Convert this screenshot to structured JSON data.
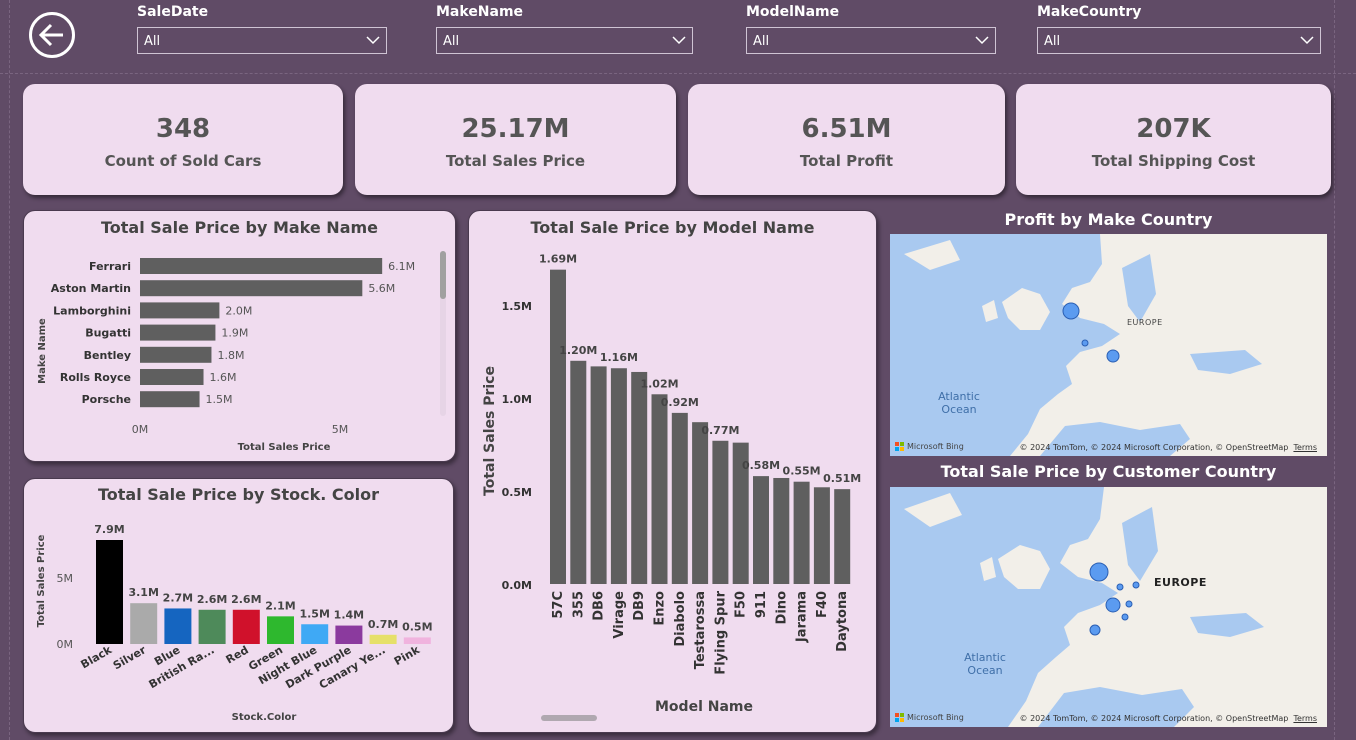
{
  "slicers": [
    {
      "title": "SaleDate",
      "value": "All"
    },
    {
      "title": "MakeName",
      "value": "All"
    },
    {
      "title": "ModelName",
      "value": "All"
    },
    {
      "title": "MakeCountry",
      "value": "All"
    }
  ],
  "kpis": [
    {
      "value": "348",
      "label": "Count of Sold Cars"
    },
    {
      "value": "25.17M",
      "label": "Total Sales Price"
    },
    {
      "value": "6.51M",
      "label": "Total Profit"
    },
    {
      "value": "207K",
      "label": "Total Shipping Cost"
    }
  ],
  "make_chart": {
    "title": "Total Sale Price by Make Name",
    "ylabel": "Make Name",
    "xlabel": "Total Sales Price",
    "ticks": [
      "0M",
      "5M"
    ]
  },
  "model_chart": {
    "title": "Total Sale Price by Model Name",
    "ylabel": "Total Sales Price",
    "xlabel": "Model Name",
    "ticks": [
      "0.0M",
      "0.5M",
      "1.0M",
      "1.5M"
    ]
  },
  "color_chart": {
    "title": "Total Sale Price by Stock. Color",
    "ylabel": "Total Sales Price",
    "xlabel": "Stock.Color",
    "ticks": [
      "0M",
      "5M"
    ]
  },
  "maps": {
    "profit": {
      "title": "Profit by Make Country",
      "ocean": "Atlantic\nOcean",
      "region": "EUROPE",
      "bing": "Microsoft Bing",
      "credit": "© 2024 TomTom, © 2024 Microsoft Corporation, © OpenStreetMap",
      "terms": "Terms"
    },
    "customer": {
      "title": "Total Sale Price by Customer Country",
      "ocean": "Atlantic\nOcean",
      "region": "EUROPE",
      "bing": "Microsoft Bing",
      "credit": "© 2024 TomTom, © 2024 Microsoft Corporation, © OpenStreetMap",
      "terms": "Terms"
    }
  },
  "chart_data": [
    {
      "type": "bar",
      "orientation": "horizontal",
      "title": "Total Sale Price by Make Name",
      "xlabel": "Total Sales Price",
      "ylabel": "Make Name",
      "categories": [
        "Ferrari",
        "Aston Martin",
        "Lamborghini",
        "Bugatti",
        "Bentley",
        "Rolls Royce",
        "Porsche"
      ],
      "values": [
        6.1,
        5.6,
        2.0,
        1.9,
        1.8,
        1.6,
        1.5
      ],
      "labels": [
        "6.1M",
        "5.6M",
        "2.0M",
        "1.9M",
        "1.8M",
        "1.6M",
        "1.5M"
      ],
      "unit": "M",
      "xlim": [
        0,
        7.2
      ],
      "color": "#5f5f5f"
    },
    {
      "type": "bar",
      "title": "Total Sale Price by Model Name",
      "xlabel": "Model Name",
      "ylabel": "Total Sales Price",
      "categories": [
        "57C",
        "355",
        "DB6",
        "Virage",
        "DB9",
        "Enzo",
        "Diabolo",
        "Testarossa",
        "Flying Spur",
        "F50",
        "911",
        "Dino",
        "Jarama",
        "F40",
        "Daytona"
      ],
      "values": [
        1.69,
        1.2,
        1.17,
        1.16,
        1.14,
        1.02,
        0.92,
        0.87,
        0.77,
        0.76,
        0.58,
        0.57,
        0.55,
        0.52,
        0.51
      ],
      "labels": [
        "1.69M",
        "1.20M",
        "",
        "1.16M",
        "",
        "1.02M",
        "0.92M",
        "",
        "0.77M",
        "",
        "0.58M",
        "",
        "0.55M",
        "",
        "0.51M"
      ],
      "unit": "M",
      "ylim": [
        0,
        1.8
      ],
      "color": "#5f5f5f"
    },
    {
      "type": "bar",
      "title": "Total Sale Price by Stock. Color",
      "xlabel": "Stock.Color",
      "ylabel": "Total Sales Price",
      "categories": [
        "Black",
        "Silver",
        "Blue",
        "British Ra...",
        "Red",
        "Green",
        "Night Blue",
        "Dark Purple",
        "Canary Ye...",
        "Pink"
      ],
      "values": [
        7.9,
        3.1,
        2.7,
        2.6,
        2.6,
        2.1,
        1.5,
        1.4,
        0.7,
        0.5
      ],
      "labels": [
        "7.9M",
        "3.1M",
        "2.7M",
        "2.6M",
        "2.6M",
        "2.1M",
        "1.5M",
        "1.4M",
        "0.7M",
        "0.5M"
      ],
      "colors": [
        "#000000",
        "#aaaaaa",
        "#1565c0",
        "#4e8a5a",
        "#d0112b",
        "#2eb82e",
        "#3fa9f5",
        "#8b3a9e",
        "#e6e06a",
        "#f0b3de"
      ],
      "unit": "M",
      "ylim": [
        0,
        8
      ]
    }
  ]
}
